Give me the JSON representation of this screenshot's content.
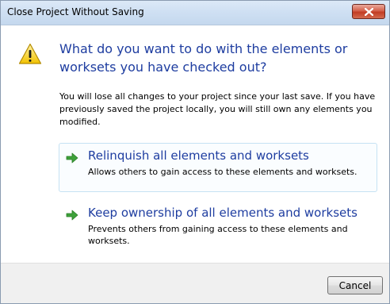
{
  "window": {
    "title": "Close Project Without Saving"
  },
  "dialog": {
    "heading": "What do you want to do with the elements or worksets you have checked out?",
    "description": "You will lose all changes to your project since your last save. If you have previously saved the project locally, you will still own any elements you modified.",
    "options": [
      {
        "title": "Relinquish all elements and worksets",
        "subtitle": "Allows others to gain access to these elements and worksets.",
        "icon": "green-arrow-icon"
      },
      {
        "title": "Keep ownership of all elements and worksets",
        "subtitle": "Prevents others from gaining access to these elements and worksets.",
        "icon": "green-arrow-icon"
      }
    ],
    "cancel_label": "Cancel"
  },
  "colors": {
    "heading": "#1e3da0",
    "titlebar": "#cfe0f3",
    "close_button": "#c23c24",
    "footer": "#f0f0f0",
    "arrow": "#3ea13a",
    "warning": "#f2c200"
  }
}
